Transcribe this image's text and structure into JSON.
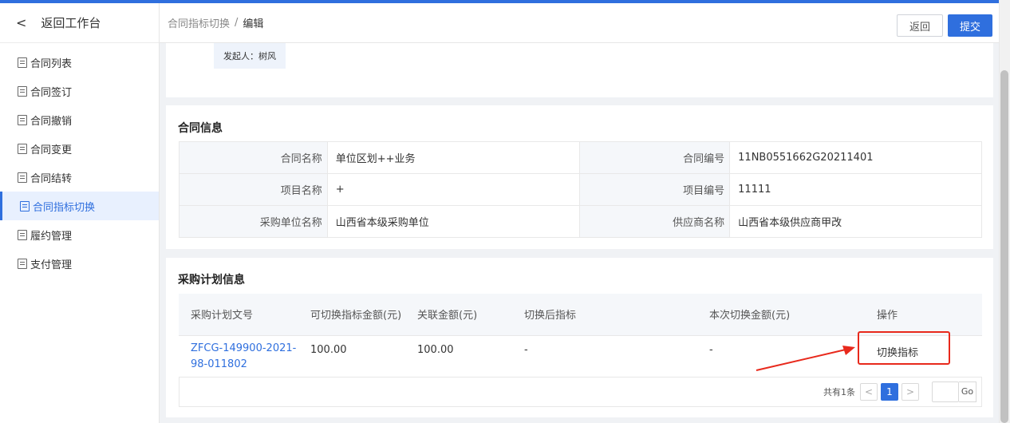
{
  "sidebar": {
    "back_label": "返回工作台",
    "items": [
      {
        "label": "合同列表"
      },
      {
        "label": "合同签订"
      },
      {
        "label": "合同撤销"
      },
      {
        "label": "合同变更"
      },
      {
        "label": "合同结转"
      },
      {
        "label": "合同指标切换",
        "active": true
      },
      {
        "label": "履约管理"
      },
      {
        "label": "支付管理"
      }
    ]
  },
  "header": {
    "breadcrumb": [
      "合同指标切换",
      "编辑"
    ],
    "separator": "/",
    "back_button": "返回",
    "submit_button": "提交"
  },
  "top_card": {
    "initiator": "发起人：树风"
  },
  "contract_info": {
    "title": "合同信息",
    "rows": [
      {
        "l1": "合同名称",
        "v1": "单位区划++业务",
        "l2": "合同编号",
        "v2": "11NB0551662G20211401"
      },
      {
        "l1": "项目名称",
        "v1": "+",
        "l2": "项目编号",
        "v2": "11111"
      },
      {
        "l1": "采购单位名称",
        "v1": "山西省本级采购单位",
        "l2": "供应商名称",
        "v2": "山西省本级供应商甲改"
      }
    ]
  },
  "plan_info": {
    "title": "采购计划信息",
    "columns": [
      "采购计划文号",
      "可切换指标金额(元)",
      "关联金额(元)",
      "切换后指标",
      "本次切换金额(元)",
      "操作"
    ],
    "rows": [
      {
        "doc_no": "ZFCG-149900-2021-98-011802",
        "switchable": "100.00",
        "related": "100.00",
        "after": "-",
        "amount": "-",
        "action": "切换指标"
      }
    ],
    "pagination": {
      "total": "共有1条",
      "prev": "<",
      "page": "1",
      "next": ">",
      "go": "Go"
    }
  },
  "colors": {
    "accent": "#2f6fde",
    "annotation": "#e8291c"
  }
}
